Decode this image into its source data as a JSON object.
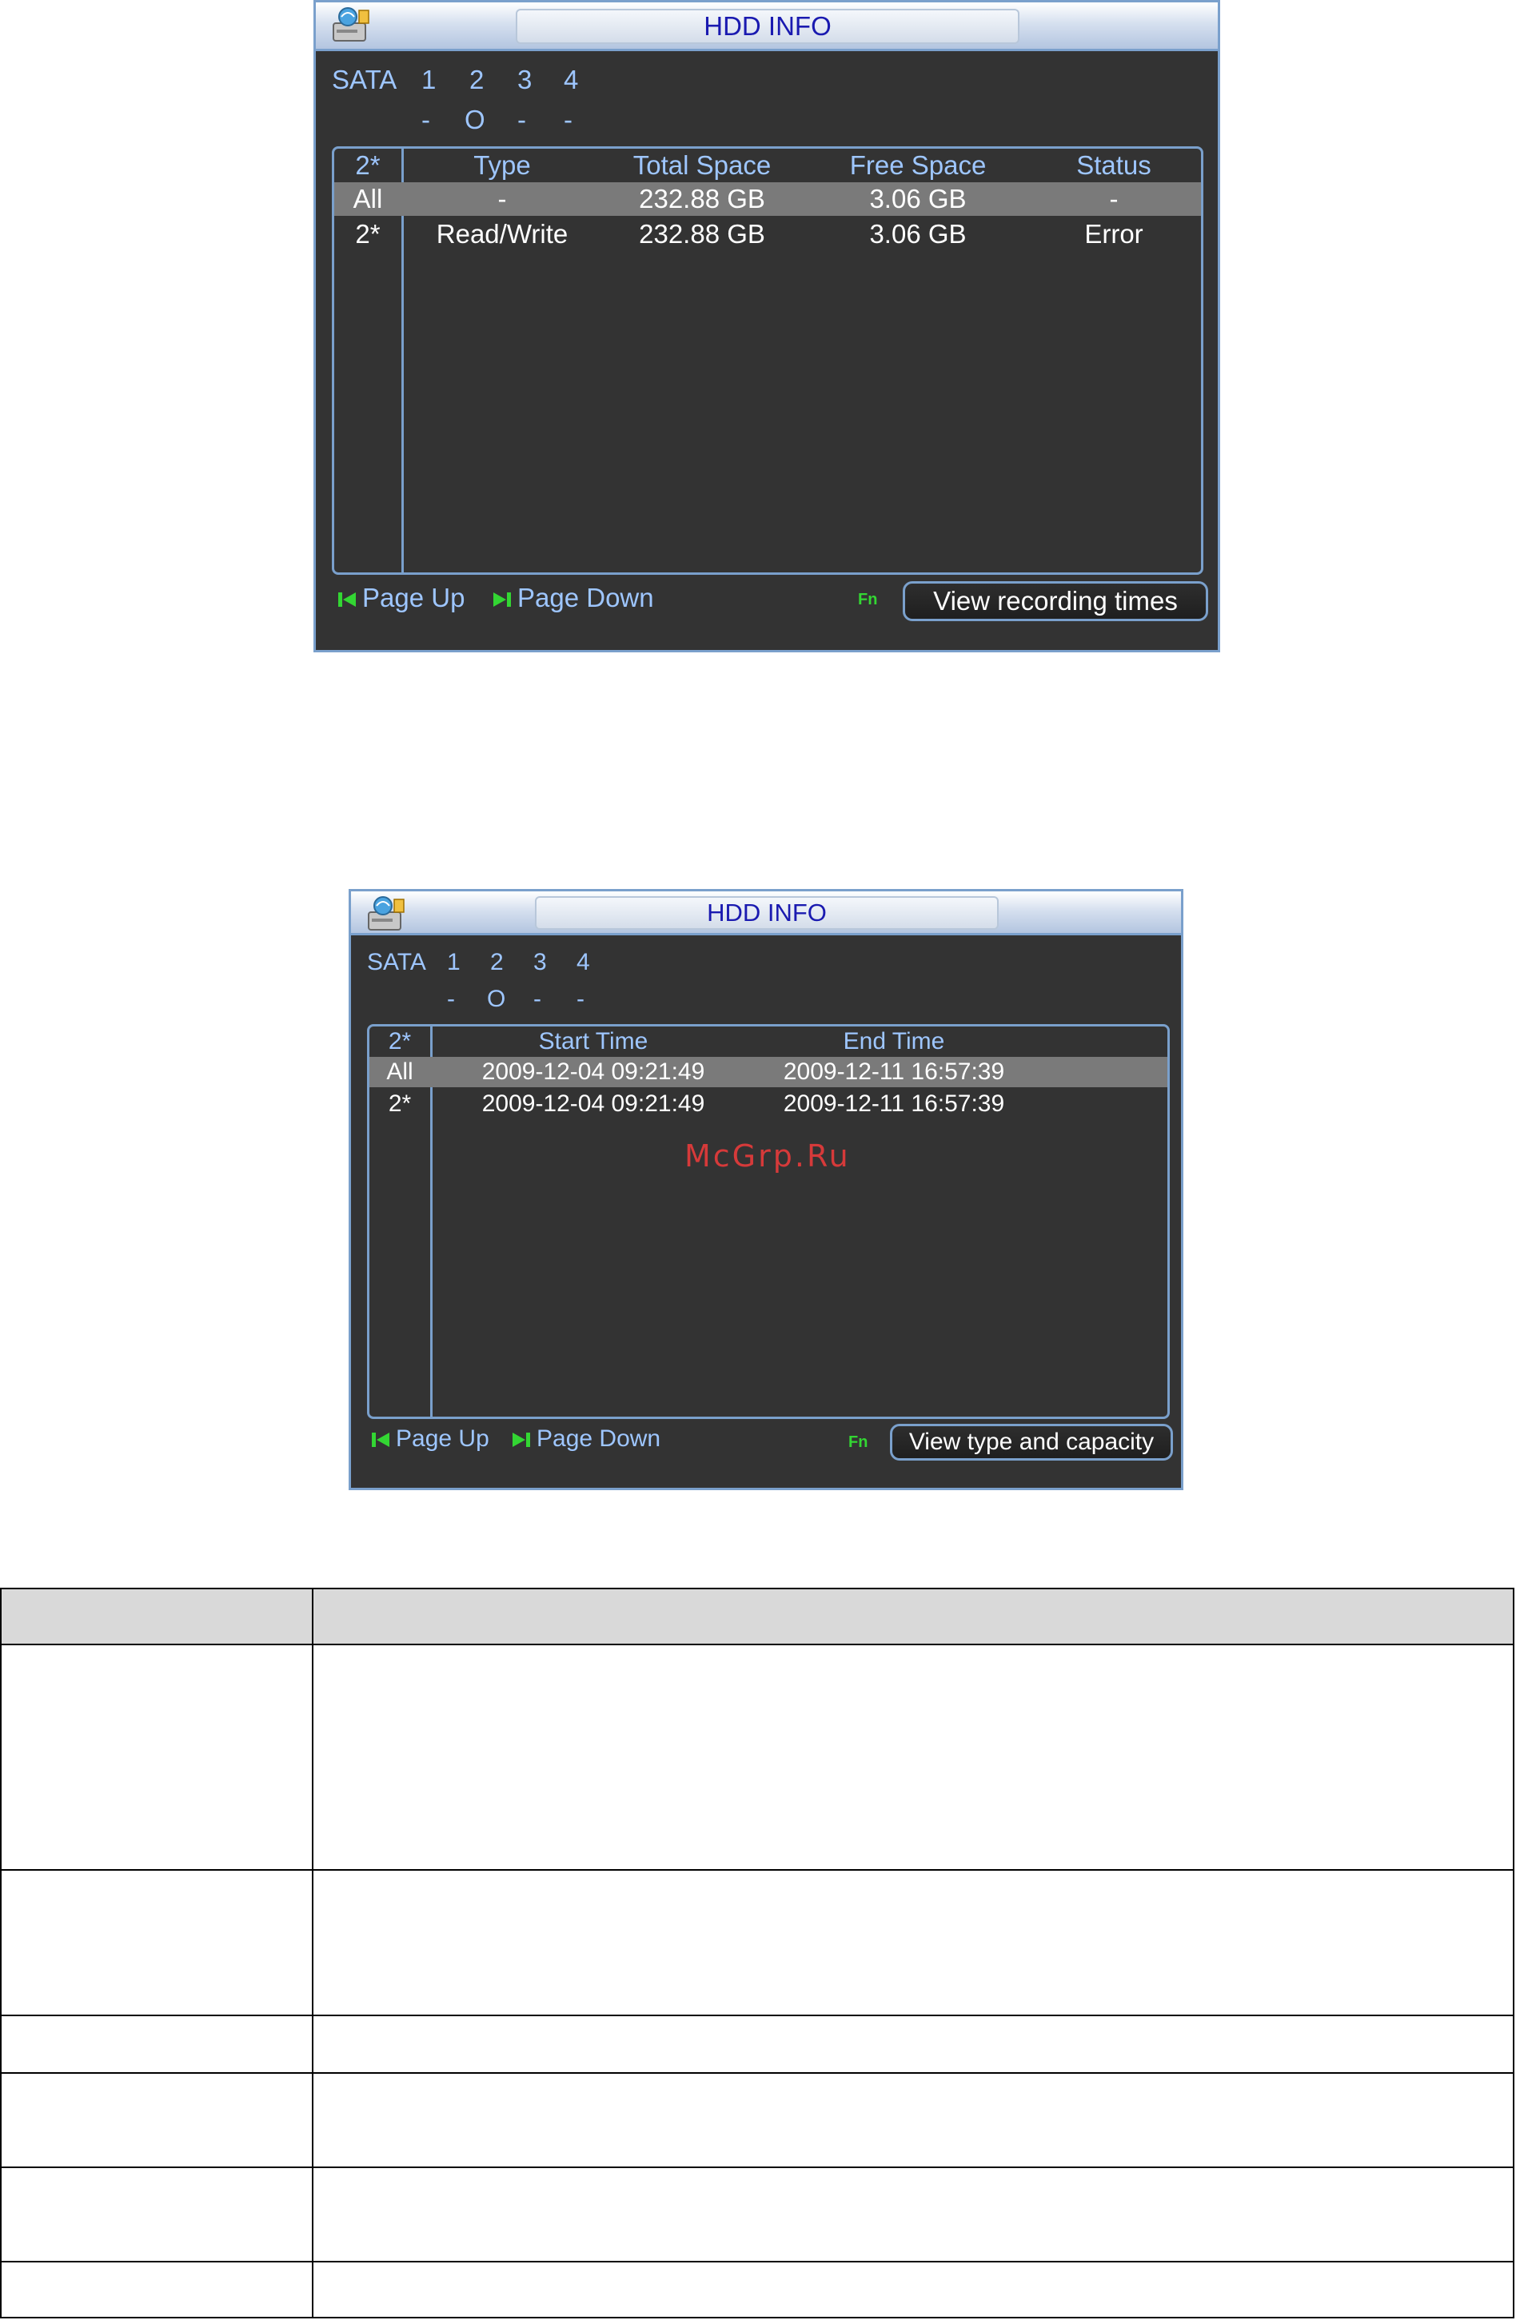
{
  "dialog1": {
    "title": "HDD INFO",
    "sata_label": "SATA",
    "sata_numbers": [
      "1",
      "2",
      "3",
      "4"
    ],
    "sata_status": [
      "-",
      "O",
      "-",
      "-"
    ],
    "columns": [
      "2*",
      "Type",
      "Total Space",
      "Free Space",
      "Status"
    ],
    "rows": [
      {
        "id": "All",
        "type": "-",
        "total": "232.88 GB",
        "free": "3.06 GB",
        "status": "-"
      },
      {
        "id": "2*",
        "type": "Read/Write",
        "total": "232.88 GB",
        "free": "3.06 GB",
        "status": "Error"
      }
    ],
    "page_up": "Page Up",
    "page_down": "Page Down",
    "fn_label": "Fn",
    "button_label": "View recording times"
  },
  "dialog2": {
    "title": "HDD INFO",
    "sata_label": "SATA",
    "sata_numbers": [
      "1",
      "2",
      "3",
      "4"
    ],
    "sata_status": [
      "-",
      "O",
      "-",
      "-"
    ],
    "columns": [
      "2*",
      "Start Time",
      "End Time"
    ],
    "rows": [
      {
        "id": "All",
        "start": "2009-12-04 09:21:49",
        "end": "2009-12-11 16:57:39"
      },
      {
        "id": "2*",
        "start": "2009-12-04 09:21:49",
        "end": "2009-12-11 16:57:39"
      }
    ],
    "page_up": "Page Up",
    "page_down": "Page Down",
    "fn_label": "Fn",
    "button_label": "View type and capacity"
  },
  "watermark": "McGrp.Ru",
  "colors": {
    "dialog_bg": "#333333",
    "frame_blue": "#7aa0cc",
    "label_blue": "#9ec6ff",
    "title_text": "#1a1ab0",
    "highlight_row": "#7a7a7a",
    "fn_green": "#33d633",
    "watermark_red": "#d63a3a"
  }
}
